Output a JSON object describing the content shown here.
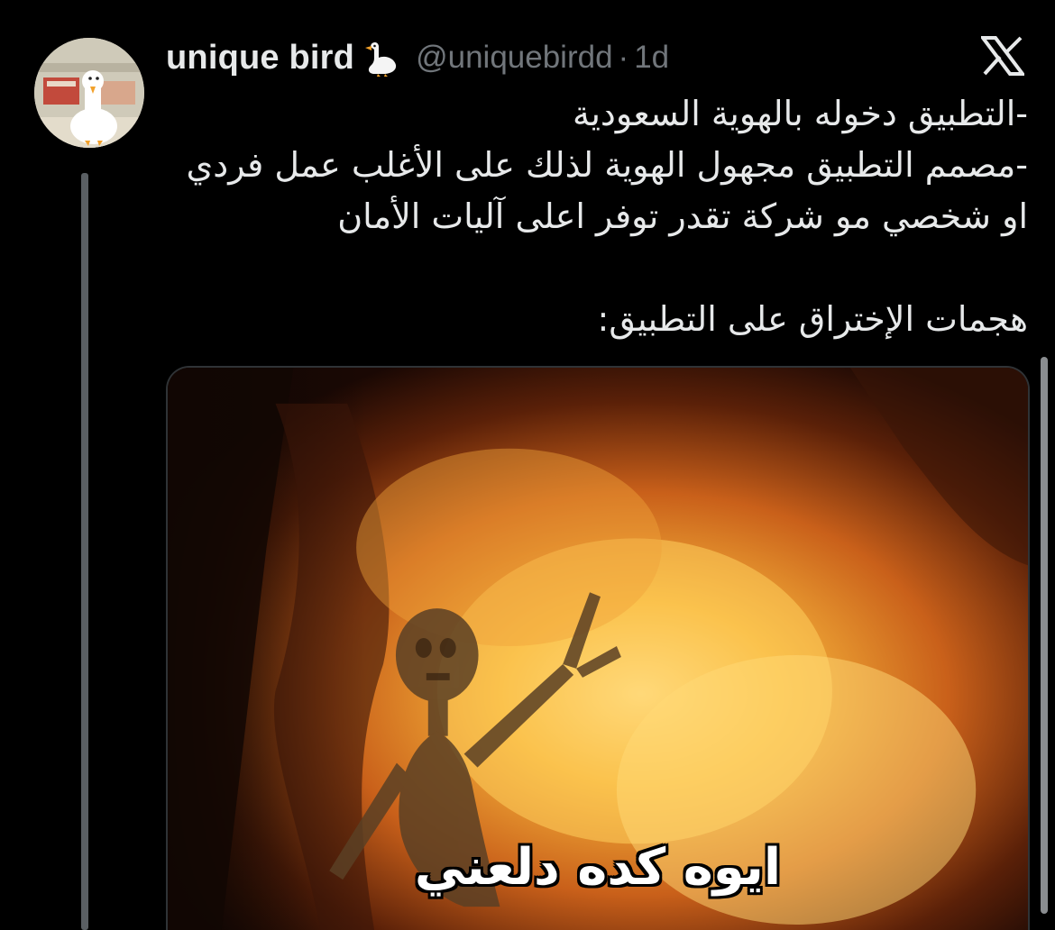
{
  "tweet": {
    "author": {
      "display_name": "unique bird",
      "badge_icon": "goose-icon",
      "handle": "@uniquebirdd",
      "separator": "·",
      "time": "1d"
    },
    "text": "-التطبيق دخوله بالهوية السعودية\n-مصمم التطبيق مجهول الهوية لذلك على الأغلب عمل فردي او شخصي مو شركة تقدر توفر اعلى آليات الأمان\n\nهجمات الإختراق على التطبيق:",
    "media": {
      "type": "image",
      "caption": "ايوه كده دلعني"
    }
  },
  "icons": {
    "logo": "x-logo-icon"
  },
  "colors": {
    "background": "#000000",
    "primary_text": "#e7e9ea",
    "secondary_text": "#71767b",
    "thread_line": "#5a5f63"
  }
}
